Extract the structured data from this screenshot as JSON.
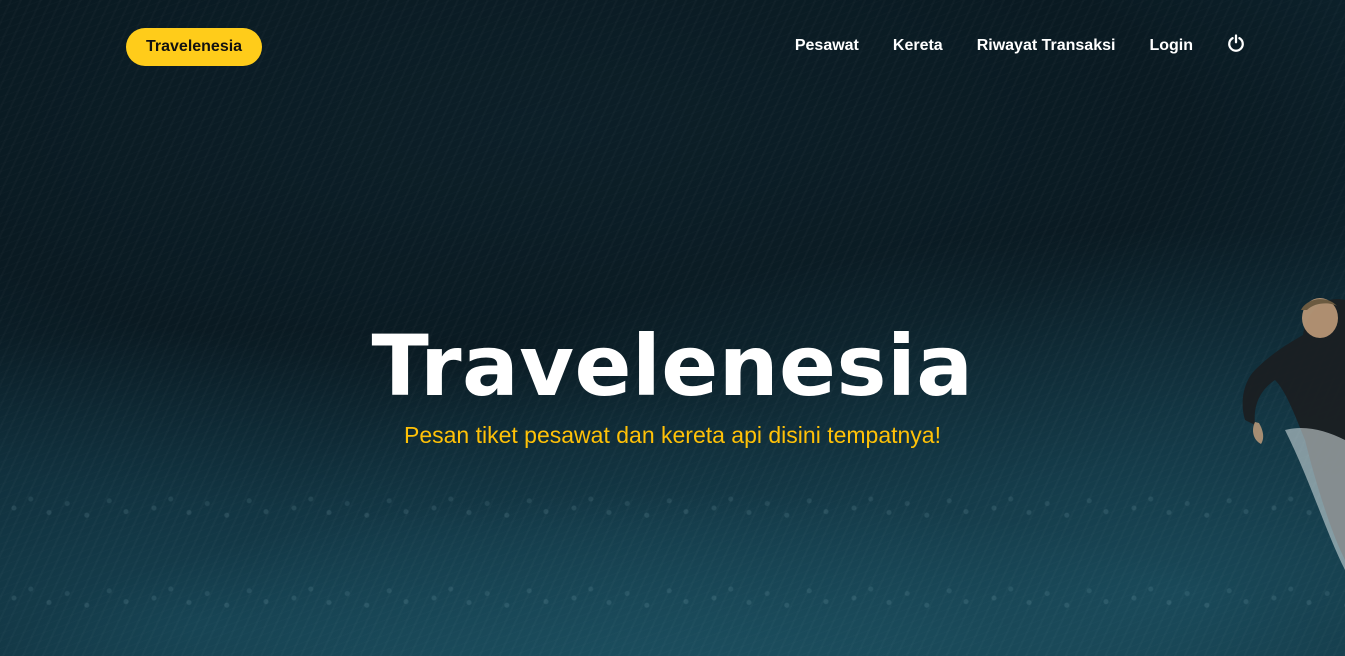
{
  "navbar": {
    "brand": "Travelenesia",
    "links": [
      "Pesawat",
      "Kereta",
      "Riwayat Transaksi",
      "Login"
    ],
    "power_icon": "power-icon"
  },
  "hero": {
    "title": "Travelenesia",
    "subtitle": "Pesan tiket pesawat dan kereta api disini tempatnya!"
  },
  "colors": {
    "accent": "#ffcc1a",
    "subtitle": "#ffc107",
    "background": "#0a1a22",
    "nav_text": "#ffffff"
  }
}
